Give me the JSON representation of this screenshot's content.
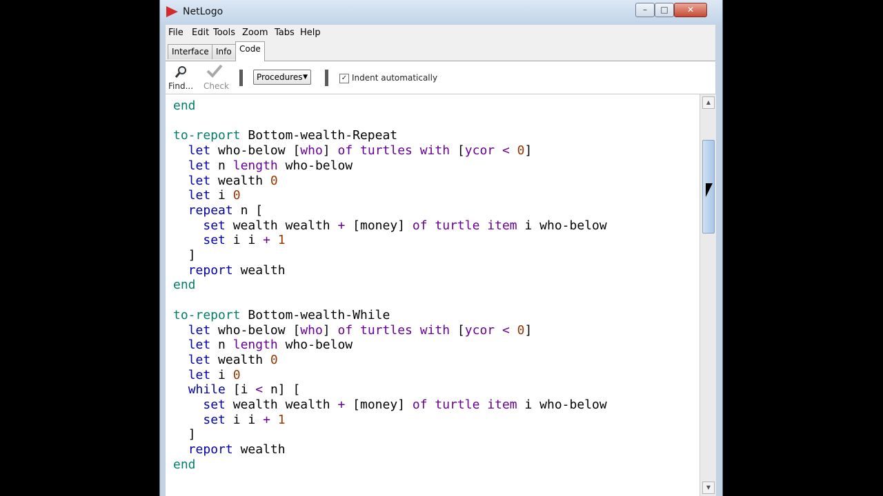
{
  "window": {
    "title": "NetLogo",
    "controls": {
      "minimize": "–",
      "maximize": "□",
      "close": "✕"
    }
  },
  "menu": [
    "File",
    "Edit",
    "Tools",
    "Zoom",
    "Tabs",
    "Help"
  ],
  "tabs": [
    {
      "label": "Interface",
      "active": false
    },
    {
      "label": "Info",
      "active": false
    },
    {
      "label": "Code",
      "active": true
    }
  ],
  "toolbar": {
    "find_label": "Find...",
    "check_label": "Check",
    "procedures_label": "Procedures",
    "indent_label": "Indent automatically",
    "indent_checked": true
  },
  "icons": {
    "app": "netlogo-logo-icon",
    "find": "magnifier-icon",
    "check": "checkmark-icon",
    "cursor": "mouse-pointer-icon"
  },
  "colors": {
    "keyword_green": "#007f69",
    "primitive_purple": "#660096",
    "command_blue": "#0000aa",
    "number": "#963700"
  },
  "code": {
    "lines": [
      "end",
      "",
      "to-report Bottom-wealth-Repeat",
      "  let who-below [who] of turtles with [ycor < 0]",
      "  let n length who-below",
      "  let wealth 0",
      "  let i 0",
      "  repeat n [",
      "    set wealth wealth + [money] of turtle item i who-below",
      "    set i i + 1",
      "  ]",
      "  report wealth",
      "end",
      "",
      "to-report Bottom-wealth-While",
      "  let who-below [who] of turtles with [ycor < 0]",
      "  let n length who-below",
      "  let wealth 0",
      "  let i 0",
      "  while [i < n] [",
      "    set wealth wealth + [money] of turtle item i who-below",
      "    set i i + 1",
      "  ]",
      "  report wealth",
      "end"
    ]
  }
}
